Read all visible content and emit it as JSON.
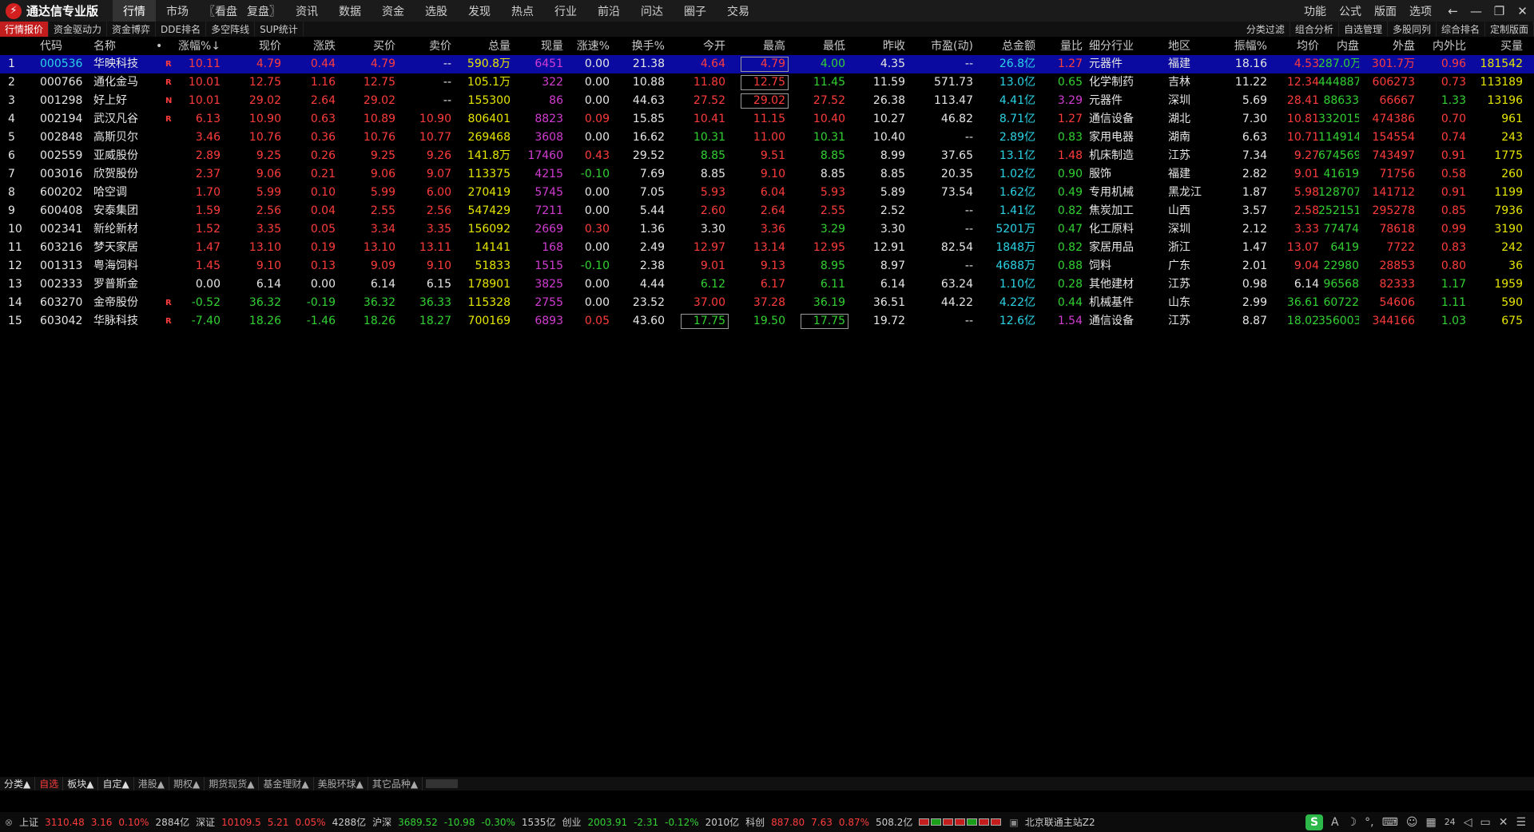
{
  "title": "通达信专业版",
  "menu": [
    "行情",
    "市场",
    "〖看盘",
    "复盘〗",
    "资讯",
    "数据",
    "资金",
    "选股",
    "发现",
    "热点",
    "行业",
    "前沿",
    "问达",
    "圈子",
    "交易"
  ],
  "right_menu": [
    "功能",
    "公式",
    "版面",
    "选项"
  ],
  "subtabs": [
    "行情报价",
    "资金驱动力",
    "资金博弈",
    "DDE排名",
    "多空阵线",
    "SUP统计"
  ],
  "subtabs_right": [
    "分类过滤",
    "组合分析",
    "自选管理",
    "多股同列",
    "综合排名",
    "定制版面"
  ],
  "headers": [
    "",
    "代码",
    "名称",
    "•",
    "涨幅%↓",
    "现价",
    "涨跌",
    "买价",
    "卖价",
    "总量",
    "现量",
    "涨速%",
    "换手%",
    "今开",
    "最高",
    "最低",
    "昨收",
    "市盈(动)",
    "总金额",
    "量比",
    "细分行业",
    "地区",
    "振幅%",
    "均价",
    "内盘",
    "外盘",
    "内外比",
    "买量"
  ],
  "rows": [
    {
      "n": "1",
      "code": "000536",
      "name": "华映科技",
      "flag": "R",
      "pct": "10.11",
      "price": "4.79",
      "chg": "0.44",
      "bid": "4.79",
      "ask": "--",
      "vol": "590.8万",
      "cur": "6451",
      "spd": "0.00",
      "turn": "21.38",
      "open": "4.64",
      "high": "4.79",
      "low": "4.00",
      "prev": "4.35",
      "pe": "--",
      "amt": "26.8亿",
      "vr": "1.27",
      "ind": "元器件",
      "reg": "福建",
      "amp": "18.16",
      "avg": "4.53",
      "inner": "287.0万",
      "outer": "301.7万",
      "ior": "0.96",
      "bv": "181542"
    },
    {
      "n": "2",
      "code": "000766",
      "name": "通化金马",
      "flag": "R",
      "pct": "10.01",
      "price": "12.75",
      "chg": "1.16",
      "bid": "12.75",
      "ask": "--",
      "vol": "105.1万",
      "cur": "322",
      "spd": "0.00",
      "turn": "10.88",
      "open": "11.80",
      "high": "12.75",
      "low": "11.45",
      "prev": "11.59",
      "pe": "571.73",
      "amt": "13.0亿",
      "vr": "0.65",
      "ind": "化学制药",
      "reg": "吉林",
      "amp": "11.22",
      "avg": "12.34",
      "inner": "444887",
      "outer": "606273",
      "ior": "0.73",
      "bv": "113189"
    },
    {
      "n": "3",
      "code": "001298",
      "name": "好上好",
      "flag": "N",
      "pct": "10.01",
      "price": "29.02",
      "chg": "2.64",
      "bid": "29.02",
      "ask": "--",
      "vol": "155300",
      "cur": "86",
      "spd": "0.00",
      "turn": "44.63",
      "open": "27.52",
      "high": "29.02",
      "low": "27.52",
      "prev": "26.38",
      "pe": "113.47",
      "amt": "4.41亿",
      "vr": "3.29",
      "ind": "元器件",
      "reg": "深圳",
      "amp": "5.69",
      "avg": "28.41",
      "inner": "88633",
      "outer": "66667",
      "ior": "1.33",
      "bv": "13196"
    },
    {
      "n": "4",
      "code": "002194",
      "name": "武汉凡谷",
      "flag": "R",
      "pct": "6.13",
      "price": "10.90",
      "chg": "0.63",
      "bid": "10.89",
      "ask": "10.90",
      "vol": "806401",
      "cur": "8823",
      "spd": "0.09",
      "turn": "15.85",
      "open": "10.41",
      "high": "11.15",
      "low": "10.40",
      "prev": "10.27",
      "pe": "46.82",
      "amt": "8.71亿",
      "vr": "1.27",
      "ind": "通信设备",
      "reg": "湖北",
      "amp": "7.30",
      "avg": "10.81",
      "inner": "332015",
      "outer": "474386",
      "ior": "0.70",
      "bv": "961"
    },
    {
      "n": "5",
      "code": "002848",
      "name": "高斯贝尔",
      "flag": "",
      "pct": "3.46",
      "price": "10.76",
      "chg": "0.36",
      "bid": "10.76",
      "ask": "10.77",
      "vol": "269468",
      "cur": "3608",
      "spd": "0.00",
      "turn": "16.62",
      "open": "10.31",
      "high": "11.00",
      "low": "10.31",
      "prev": "10.40",
      "pe": "--",
      "amt": "2.89亿",
      "vr": "0.83",
      "ind": "家用电器",
      "reg": "湖南",
      "amp": "6.63",
      "avg": "10.71",
      "inner": "114914",
      "outer": "154554",
      "ior": "0.74",
      "bv": "243"
    },
    {
      "n": "6",
      "code": "002559",
      "name": "亚威股份",
      "flag": "",
      "pct": "2.89",
      "price": "9.25",
      "chg": "0.26",
      "bid": "9.25",
      "ask": "9.26",
      "vol": "141.8万",
      "cur": "17460",
      "spd": "0.43",
      "turn": "29.52",
      "open": "8.85",
      "high": "9.51",
      "low": "8.85",
      "prev": "8.99",
      "pe": "37.65",
      "amt": "13.1亿",
      "vr": "1.48",
      "ind": "机床制造",
      "reg": "江苏",
      "amp": "7.34",
      "avg": "9.27",
      "inner": "674569",
      "outer": "743497",
      "ior": "0.91",
      "bv": "1775"
    },
    {
      "n": "7",
      "code": "003016",
      "name": "欣贺股份",
      "flag": "",
      "pct": "2.37",
      "price": "9.06",
      "chg": "0.21",
      "bid": "9.06",
      "ask": "9.07",
      "vol": "113375",
      "cur": "4215",
      "spd": "-0.10",
      "turn": "7.69",
      "open": "8.85",
      "high": "9.10",
      "low": "8.85",
      "prev": "8.85",
      "pe": "20.35",
      "amt": "1.02亿",
      "vr": "0.90",
      "ind": "服饰",
      "reg": "福建",
      "amp": "2.82",
      "avg": "9.01",
      "inner": "41619",
      "outer": "71756",
      "ior": "0.58",
      "bv": "260"
    },
    {
      "n": "8",
      "code": "600202",
      "name": "哈空调",
      "flag": "",
      "pct": "1.70",
      "price": "5.99",
      "chg": "0.10",
      "bid": "5.99",
      "ask": "6.00",
      "vol": "270419",
      "cur": "5745",
      "spd": "0.00",
      "turn": "7.05",
      "open": "5.93",
      "high": "6.04",
      "low": "5.93",
      "prev": "5.89",
      "pe": "73.54",
      "amt": "1.62亿",
      "vr": "0.49",
      "ind": "专用机械",
      "reg": "黑龙江",
      "amp": "1.87",
      "avg": "5.98",
      "inner": "128707",
      "outer": "141712",
      "ior": "0.91",
      "bv": "1199"
    },
    {
      "n": "9",
      "code": "600408",
      "name": "安泰集团",
      "flag": "",
      "pct": "1.59",
      "price": "2.56",
      "chg": "0.04",
      "bid": "2.55",
      "ask": "2.56",
      "vol": "547429",
      "cur": "7211",
      "spd": "0.00",
      "turn": "5.44",
      "open": "2.60",
      "high": "2.64",
      "low": "2.55",
      "prev": "2.52",
      "pe": "--",
      "amt": "1.41亿",
      "vr": "0.82",
      "ind": "焦炭加工",
      "reg": "山西",
      "amp": "3.57",
      "avg": "2.58",
      "inner": "252151",
      "outer": "295278",
      "ior": "0.85",
      "bv": "7936"
    },
    {
      "n": "10",
      "code": "002341",
      "name": "新纶新材",
      "flag": "",
      "pct": "1.52",
      "price": "3.35",
      "chg": "0.05",
      "bid": "3.34",
      "ask": "3.35",
      "vol": "156092",
      "cur": "2669",
      "spd": "0.30",
      "turn": "1.36",
      "open": "3.30",
      "high": "3.36",
      "low": "3.29",
      "prev": "3.30",
      "pe": "--",
      "amt": "5201万",
      "vr": "0.47",
      "ind": "化工原料",
      "reg": "深圳",
      "amp": "2.12",
      "avg": "3.33",
      "inner": "77474",
      "outer": "78618",
      "ior": "0.99",
      "bv": "3190"
    },
    {
      "n": "11",
      "code": "603216",
      "name": "梦天家居",
      "flag": "",
      "pct": "1.47",
      "price": "13.10",
      "chg": "0.19",
      "bid": "13.10",
      "ask": "13.11",
      "vol": "14141",
      "cur": "168",
      "spd": "0.00",
      "turn": "2.49",
      "open": "12.97",
      "high": "13.14",
      "low": "12.95",
      "prev": "12.91",
      "pe": "82.54",
      "amt": "1848万",
      "vr": "0.82",
      "ind": "家居用品",
      "reg": "浙江",
      "amp": "1.47",
      "avg": "13.07",
      "inner": "6419",
      "outer": "7722",
      "ior": "0.83",
      "bv": "242"
    },
    {
      "n": "12",
      "code": "001313",
      "name": "粤海饲料",
      "flag": "",
      "pct": "1.45",
      "price": "9.10",
      "chg": "0.13",
      "bid": "9.09",
      "ask": "9.10",
      "vol": "51833",
      "cur": "1515",
      "spd": "-0.10",
      "turn": "2.38",
      "open": "9.01",
      "high": "9.13",
      "low": "8.95",
      "prev": "8.97",
      "pe": "--",
      "amt": "4688万",
      "vr": "0.88",
      "ind": "饲料",
      "reg": "广东",
      "amp": "2.01",
      "avg": "9.04",
      "inner": "22980",
      "outer": "28853",
      "ior": "0.80",
      "bv": "36"
    },
    {
      "n": "13",
      "code": "002333",
      "name": "罗普斯金",
      "flag": "",
      "pct": "0.00",
      "price": "6.14",
      "chg": "0.00",
      "bid": "6.14",
      "ask": "6.15",
      "vol": "178901",
      "cur": "3825",
      "spd": "0.00",
      "turn": "4.44",
      "open": "6.12",
      "high": "6.17",
      "low": "6.11",
      "prev": "6.14",
      "pe": "63.24",
      "amt": "1.10亿",
      "vr": "0.28",
      "ind": "其他建材",
      "reg": "江苏",
      "amp": "0.98",
      "avg": "6.14",
      "inner": "96568",
      "outer": "82333",
      "ior": "1.17",
      "bv": "1959"
    },
    {
      "n": "14",
      "code": "603270",
      "name": "金帝股份",
      "flag": "R",
      "pct": "-0.52",
      "price": "36.32",
      "chg": "-0.19",
      "bid": "36.32",
      "ask": "36.33",
      "vol": "115328",
      "cur": "2755",
      "spd": "0.00",
      "turn": "23.52",
      "open": "37.00",
      "high": "37.28",
      "low": "36.19",
      "prev": "36.51",
      "pe": "44.22",
      "amt": "4.22亿",
      "vr": "0.44",
      "ind": "机械基件",
      "reg": "山东",
      "amp": "2.99",
      "avg": "36.61",
      "inner": "60722",
      "outer": "54606",
      "ior": "1.11",
      "bv": "590"
    },
    {
      "n": "15",
      "code": "603042",
      "name": "华脉科技",
      "flag": "R",
      "pct": "-7.40",
      "price": "18.26",
      "chg": "-1.46",
      "bid": "18.26",
      "ask": "18.27",
      "vol": "700169",
      "cur": "6893",
      "spd": "0.05",
      "turn": "43.60",
      "open": "17.75",
      "high": "19.50",
      "low": "17.75",
      "prev": "19.72",
      "pe": "--",
      "amt": "12.6亿",
      "vr": "1.54",
      "ind": "通信设备",
      "reg": "江苏",
      "amp": "8.87",
      "avg": "18.02",
      "inner": "356003",
      "outer": "344166",
      "ior": "1.03",
      "bv": "675"
    }
  ],
  "bottom_tabs": [
    "分类▲",
    "自选",
    "板块▲",
    "自定▲",
    "港股▲",
    "期权▲",
    "期货现货▲",
    "基金理财▲",
    "美股环球▲",
    "其它品种▲"
  ],
  "status": {
    "sh_label": "上证",
    "sh_val": "3110.48",
    "sh_chg": "3.16",
    "sh_pct": "0.10%",
    "sh_amt": "2884亿",
    "sz_label": "深证",
    "sz_val": "10109.5",
    "sz_chg": "5.21",
    "sz_pct": "0.05%",
    "sz_amt": "4288亿",
    "hs_label": "沪深",
    "hs_val": "3689.52",
    "hs_chg": "-10.98",
    "hs_pct": "-0.30%",
    "hs_amt": "1535亿",
    "cy_label": "创业",
    "cy_val": "2003.91",
    "cy_chg": "-2.31",
    "cy_pct": "-0.12%",
    "cy_amt": "2010亿",
    "kc_label": "科创",
    "kc_val": "887.80",
    "kc_chg": "7.63",
    "kc_pct": "0.87%",
    "kc_amt": "508.2亿",
    "server": "北京联通主站Z2",
    "clock": "24"
  },
  "colors": {
    "up": "#ff3c3c",
    "down": "#32d232",
    "selected_row": "#0a0aa0",
    "accent": "#c41d1d"
  }
}
